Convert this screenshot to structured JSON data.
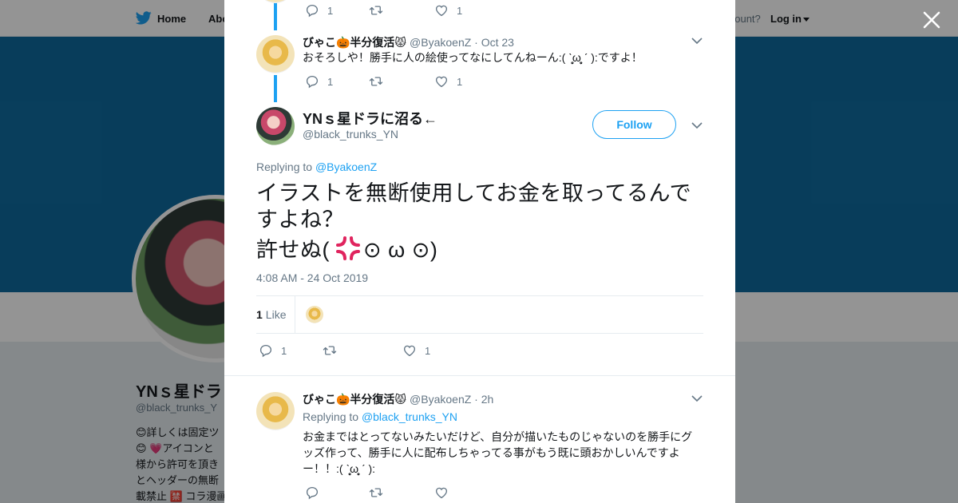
{
  "nav": {
    "home_label": "Home",
    "about_label": "Abo",
    "account_question": "account?",
    "login_label": "Log in"
  },
  "background_profile": {
    "name": "YNｓ星ドラ",
    "handle": "@black_trunks_Y",
    "bio_lines": [
      "😊詳しくは固定ツ",
      "😊 💗アイコンと",
      "様から許可を頂き",
      "とヘッダーの無断",
      "載禁止 🈲 コラ漫画"
    ]
  },
  "tweets": [
    {
      "counts": {
        "reply": "1",
        "retweet": "",
        "like": "1"
      }
    },
    {
      "name": "びゃこ🎃半分復活😾",
      "handle": "@ByakoenZ",
      "date": "· Oct 23",
      "text": "おそろしや！勝手に人の絵使ってなにしてんねーん:( ˋ̥̥̥̥̥̥̥̥ω̥̥̥̥̥̥̥̥ ˊ ):ですよ！",
      "counts": {
        "reply": "1",
        "retweet": "",
        "like": "1"
      }
    }
  ],
  "main_tweet": {
    "name": "YNｓ星ドラに沼る←",
    "handle": "@black_trunks_YN",
    "follow_label": "Follow",
    "replying_prefix": "Replying to ",
    "replying_to": "@ByakoenZ",
    "text_line1": "イラストを無断使用してお金を取ってるんで",
    "text_line2": "すよね？",
    "text_line3_a": "許せぬ(",
    "text_line3_b": "⊙ ω ⊙)",
    "timestamp": "4:08 AM - 24 Oct 2019",
    "like_count": "1",
    "like_label": "Like",
    "counts": {
      "reply": "1",
      "retweet": "",
      "like": "1"
    }
  },
  "reply_tweet": {
    "name": "びゃこ🎃半分復活😾",
    "handle": "@ByakoenZ",
    "date": "· 2h",
    "replying_prefix": "Replying to ",
    "replying_to": "@black_trunks_YN",
    "text_line1": "お金まではとってないみたいだけど、自分が描いたものじゃないのを勝手にグ",
    "text_line2": "ッズ作って、勝手に人に配布しちゃってる事がもう既に頭おかしいんですよ",
    "text_line3": "ー！！:( ˋ̥̥̥̥̥̥̥̥ω̥̥̥̥̥̥̥̥ ˊ ):",
    "counts": {
      "reply": "",
      "retweet": "",
      "like": ""
    }
  },
  "colors": {
    "twitter_blue": "#1da1f2",
    "banner": "#0f6a9e",
    "secondary_text": "#657786"
  }
}
